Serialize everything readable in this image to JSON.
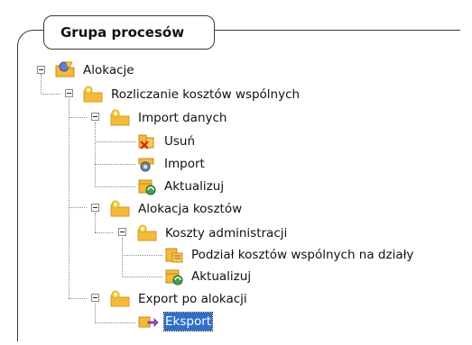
{
  "panel": {
    "title": "Grupa procesów"
  },
  "tree": {
    "root": {
      "label": "Alokacje",
      "icon": "process-root-icon"
    },
    "group": {
      "label": "Rozliczanie kosztów wspólnych",
      "icon": "folder-gear-icon"
    },
    "import_section": {
      "label": "Import danych",
      "icon": "folder-gear-icon",
      "items": [
        {
          "label": "Usuń",
          "icon": "delete-icon"
        },
        {
          "label": "Import",
          "icon": "import-icon"
        },
        {
          "label": "Aktualizuj",
          "icon": "refresh-icon"
        }
      ]
    },
    "allocation_section": {
      "label": "Alokacja kosztów",
      "icon": "folder-gear-icon",
      "sub": {
        "label": "Koszty administracji",
        "icon": "folder-gear-icon",
        "items": [
          {
            "label": "Podział kosztów wspólnych na działy",
            "icon": "split-icon"
          },
          {
            "label": "Aktualizuj",
            "icon": "refresh-icon"
          }
        ]
      }
    },
    "export_section": {
      "label": "Export po alokacji",
      "icon": "folder-gear-icon",
      "items": [
        {
          "label": "Eksport",
          "icon": "export-icon",
          "selected": true
        }
      ]
    }
  },
  "colors": {
    "selection": "#2f6fc7",
    "folder": "#f5b93b",
    "gear": "#f7d64a"
  }
}
